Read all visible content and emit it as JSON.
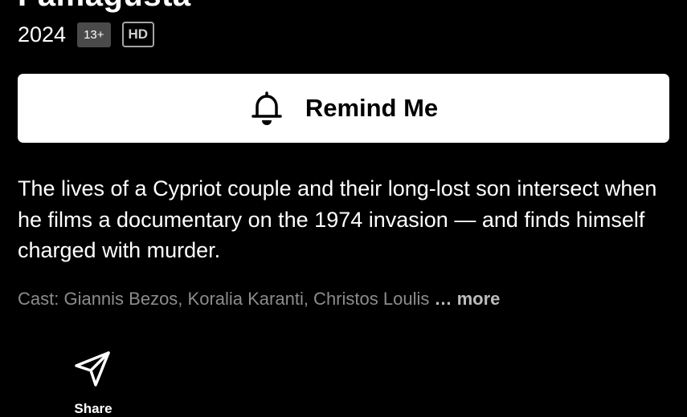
{
  "title": {
    "name": "Famagusta"
  },
  "meta": {
    "year": "2024",
    "rating": "13+",
    "quality": "HD"
  },
  "remind_button": {
    "label": "Remind Me",
    "icon": "bell-icon"
  },
  "synopsis": "The lives of a Cypriot couple and their long-lost son intersect when he films a documentary on the 1974 invasion — and finds himself charged with murder.",
  "cast": {
    "text": "Cast: Giannis Bezos, Koralia Karanti, Christos Loulis",
    "more_label": "… more"
  },
  "actions": {
    "share_label": "Share",
    "share_icon": "paper-plane-icon"
  },
  "colors": {
    "background": "#000000",
    "button_bg": "#ffffff",
    "muted_text": "#8c8c8c",
    "badge_bg": "#4a4a4a"
  }
}
